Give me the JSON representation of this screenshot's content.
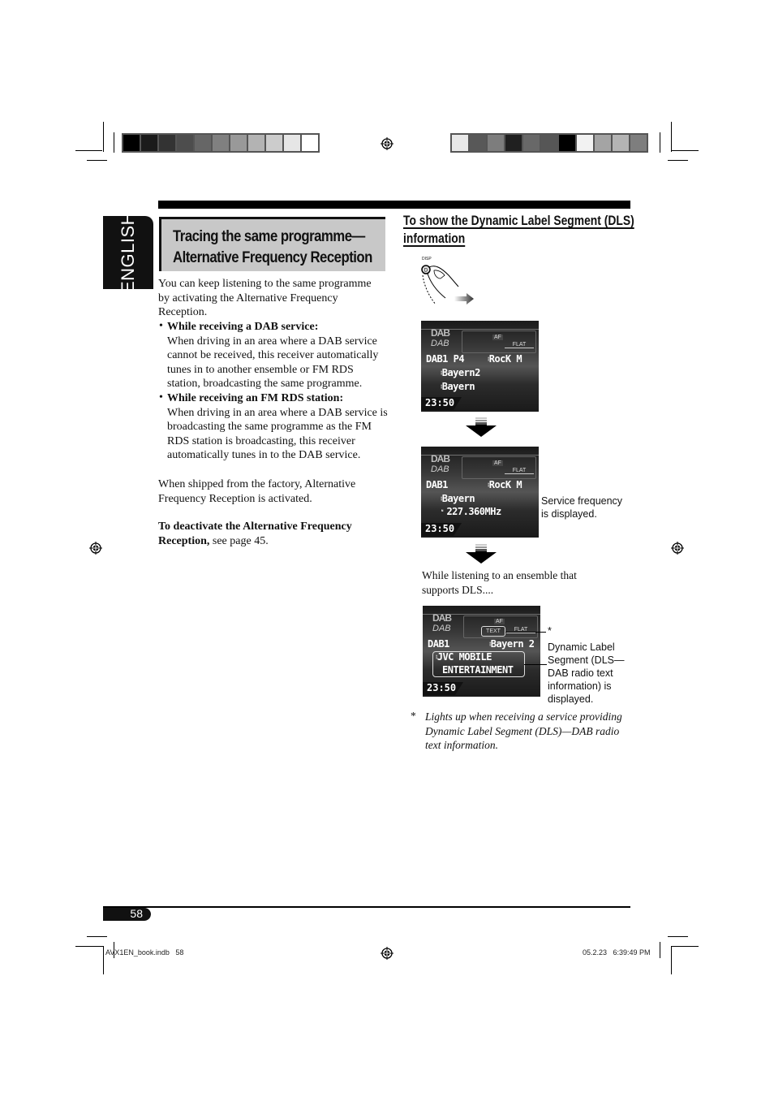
{
  "color_bars": {
    "left": [
      "#000000",
      "#1b1b1b",
      "#333333",
      "#4d4d4d",
      "#666666",
      "#808080",
      "#999999",
      "#b3b3b3",
      "#cccccc",
      "#e6e6e6",
      "#ffffff"
    ],
    "right": [
      "#e8e8e8",
      "#585858",
      "#7d7d7d",
      "#202020",
      "#686868",
      "#565656",
      "#000000",
      "#f2f2f2",
      "#a4a4a4",
      "#b4b4b4",
      "#7e7e7e"
    ]
  },
  "language_tab": "ENGLISH",
  "title": {
    "line1": "Tracing the same programme—",
    "line2": "Alternative Frequency Reception"
  },
  "left_column": {
    "intro": "You can keep listening to the same programme by activating the Alternative Frequency Reception.",
    "bullets": [
      {
        "heading": "While receiving a DAB service:",
        "text": "When driving in an area where a DAB service cannot be received, this receiver automatically tunes in to another ensemble or FM RDS station, broadcasting the same programme."
      },
      {
        "heading": "While receiving an FM RDS station:",
        "text": "When driving in an area where a DAB service is broadcasting the same programme as the FM RDS station is broadcasting, this receiver automatically tunes in to the DAB service."
      }
    ],
    "factory_note": "When shipped from the factory, Alternative Frequency Reception is activated.",
    "deactivate_bold": "To deactivate the Alternative Frequency Reception,",
    "deactivate_rest": " see page 45."
  },
  "right_column": {
    "heading_line1": "To show the Dynamic Label Segment (DLS)",
    "heading_line2": "information",
    "disp_button_label": "DISP",
    "disp_button_glyph": "D",
    "displays": [
      {
        "logo": "DAB",
        "logo_sub": "DAB",
        "af": "AF",
        "flat": "FLAT",
        "row1_left": "DAB1 P4",
        "row1_right": "RocK M",
        "row2": "Bayern2",
        "row3": "Bayern",
        "clock": "23:50"
      },
      {
        "logo": "DAB",
        "logo_sub": "DAB",
        "af": "AF",
        "flat": "FLAT",
        "row1_left": "DAB1",
        "row1_right": "RocK M",
        "row2": "Bayern",
        "row3": "227.360MHz",
        "clock": "23:50"
      },
      {
        "logo": "DAB",
        "logo_sub": "DAB",
        "af": "AF",
        "text_indicator": "TEXT",
        "flat": "FLAT",
        "row1_left": "DAB1",
        "row1_right": "Bayern 2",
        "row2": "JVC MOBILE",
        "row3": "ENTERTAINMENT",
        "clock": "23:50"
      }
    ],
    "caption_frequency": "Service frequency is displayed.",
    "dls_intro": "While listening to an ensemble that supports DLS....",
    "asterisk": "*",
    "caption_dls": "Dynamic Label Segment (DLS—DAB radio text information) is displayed.",
    "footnote_mark": "*",
    "footnote": "Lights up when receiving a service providing Dynamic Label Segment (DLS)—DAB radio text information."
  },
  "footer": {
    "page_number": "58",
    "file_slug": "AVX1EN_book.indb   58",
    "timestamp": "05.2.23   6:39:49 PM"
  }
}
